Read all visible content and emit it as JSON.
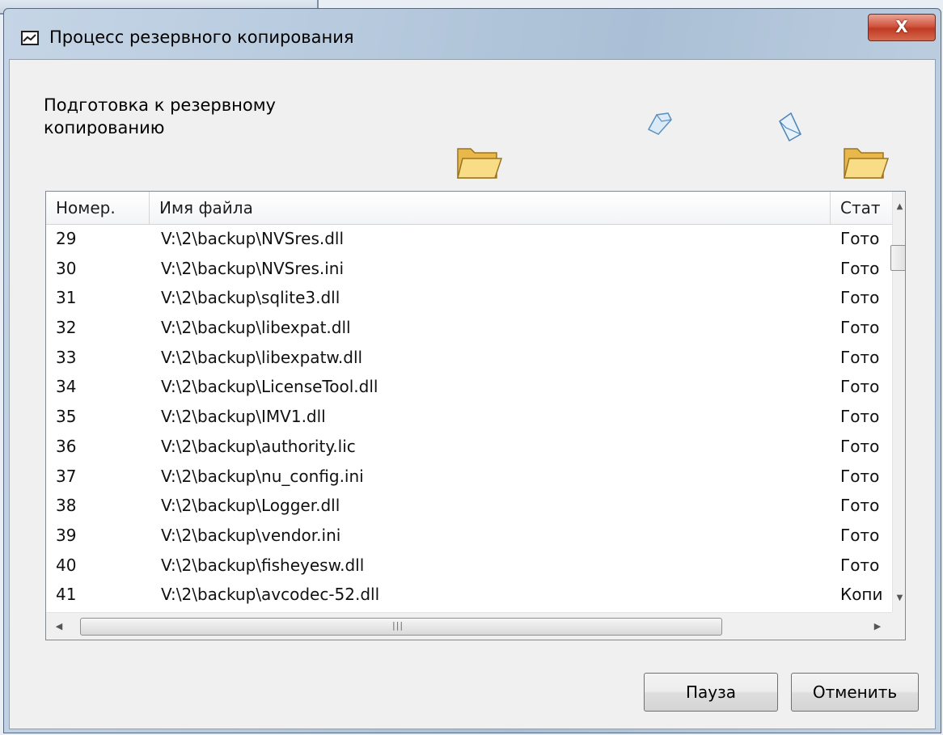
{
  "window": {
    "title": "Процесс резервного копирования",
    "close_label": "X"
  },
  "status_text": "Подготовка к резервному копированию",
  "list": {
    "columns": [
      "Номер.",
      "Имя файла",
      "Стат"
    ],
    "rows": [
      {
        "num": "29",
        "file": "V:\\2\\backup\\NVSres.dll",
        "status": "Гото"
      },
      {
        "num": "30",
        "file": "V:\\2\\backup\\NVSres.ini",
        "status": "Гото"
      },
      {
        "num": "31",
        "file": "V:\\2\\backup\\sqlite3.dll",
        "status": "Гото"
      },
      {
        "num": "32",
        "file": "V:\\2\\backup\\libexpat.dll",
        "status": "Гото"
      },
      {
        "num": "33",
        "file": "V:\\2\\backup\\libexpatw.dll",
        "status": "Гото"
      },
      {
        "num": "34",
        "file": "V:\\2\\backup\\LicenseTool.dll",
        "status": "Гото"
      },
      {
        "num": "35",
        "file": "V:\\2\\backup\\IMV1.dll",
        "status": "Гото"
      },
      {
        "num": "36",
        "file": "V:\\2\\backup\\authority.lic",
        "status": "Гото"
      },
      {
        "num": "37",
        "file": "V:\\2\\backup\\nu_config.ini",
        "status": "Гото"
      },
      {
        "num": "38",
        "file": "V:\\2\\backup\\Logger.dll",
        "status": "Гото"
      },
      {
        "num": "39",
        "file": "V:\\2\\backup\\vendor.ini",
        "status": "Гото"
      },
      {
        "num": "40",
        "file": "V:\\2\\backup\\fisheyesw.dll",
        "status": "Гото"
      },
      {
        "num": "41",
        "file": "V:\\2\\backup\\avcodec-52.dll",
        "status": "Копи"
      }
    ]
  },
  "icons": {
    "title": "window-app-icon",
    "source_folder": "folder-icon",
    "dest_folder": "folder-icon",
    "flying_doc": "document-icon"
  },
  "buttons": {
    "pause": "Пауза",
    "cancel": "Отменить"
  }
}
